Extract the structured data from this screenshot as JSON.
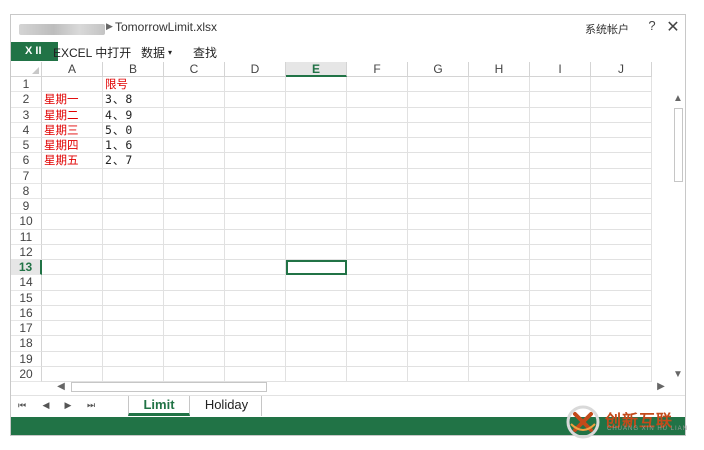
{
  "window": {
    "filename": "TomorrowLimit.xlsx",
    "account": "系统帐户",
    "help": "?",
    "close": "✕"
  },
  "menubar": {
    "badge": "X II",
    "open_in_excel": "EXCEL 中打开",
    "data_menu": "数据",
    "data_caret": "▾",
    "find": "查找"
  },
  "columns": [
    "A",
    "B",
    "C",
    "D",
    "E",
    "F",
    "G",
    "H",
    "I",
    "J"
  ],
  "active_column": "E",
  "rows": [
    "1",
    "2",
    "3",
    "4",
    "5",
    "6",
    "7",
    "8",
    "9",
    "10",
    "11",
    "12",
    "13",
    "14",
    "15",
    "16",
    "17",
    "18",
    "19",
    "20"
  ],
  "active_row": "13",
  "cells": [
    [
      "",
      "限号"
    ],
    [
      "星期一",
      "3、8"
    ],
    [
      "星期二",
      "4、9"
    ],
    [
      "星期三",
      "5、0"
    ],
    [
      "星期四",
      "1、6"
    ],
    [
      "星期五",
      "2、7"
    ]
  ],
  "selected_cell": "E13",
  "sheets": {
    "nav": [
      "⏮",
      "◀",
      "▶",
      "⏭"
    ],
    "active": "Limit",
    "other": "Holiday"
  },
  "scroll": {
    "up": "▲",
    "down": "▼",
    "left": "◀",
    "right": "▶"
  },
  "watermark": {
    "text": "创新互联",
    "sub": "CHUANG XIN HU LIAN"
  },
  "colors": {
    "excel_green": "#217346",
    "cell_text_red": "#e00000",
    "watermark_orange": "#c44a1a"
  }
}
